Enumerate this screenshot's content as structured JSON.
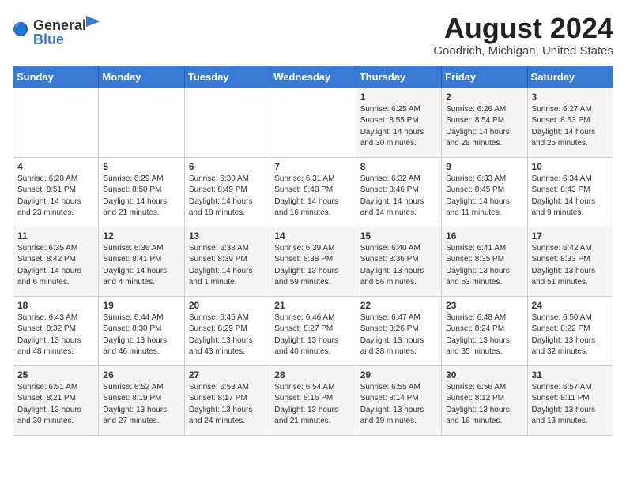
{
  "header": {
    "logo_general": "General",
    "logo_blue": "Blue",
    "month_year": "August 2024",
    "location": "Goodrich, Michigan, United States"
  },
  "days_of_week": [
    "Sunday",
    "Monday",
    "Tuesday",
    "Wednesday",
    "Thursday",
    "Friday",
    "Saturday"
  ],
  "weeks": [
    [
      {
        "day": "",
        "info": ""
      },
      {
        "day": "",
        "info": ""
      },
      {
        "day": "",
        "info": ""
      },
      {
        "day": "",
        "info": ""
      },
      {
        "day": "1",
        "info": "Sunrise: 6:25 AM\nSunset: 8:55 PM\nDaylight: 14 hours\nand 30 minutes."
      },
      {
        "day": "2",
        "info": "Sunrise: 6:26 AM\nSunset: 8:54 PM\nDaylight: 14 hours\nand 28 minutes."
      },
      {
        "day": "3",
        "info": "Sunrise: 6:27 AM\nSunset: 8:53 PM\nDaylight: 14 hours\nand 25 minutes."
      }
    ],
    [
      {
        "day": "4",
        "info": "Sunrise: 6:28 AM\nSunset: 8:51 PM\nDaylight: 14 hours\nand 23 minutes."
      },
      {
        "day": "5",
        "info": "Sunrise: 6:29 AM\nSunset: 8:50 PM\nDaylight: 14 hours\nand 21 minutes."
      },
      {
        "day": "6",
        "info": "Sunrise: 6:30 AM\nSunset: 8:49 PM\nDaylight: 14 hours\nand 18 minutes."
      },
      {
        "day": "7",
        "info": "Sunrise: 6:31 AM\nSunset: 8:48 PM\nDaylight: 14 hours\nand 16 minutes."
      },
      {
        "day": "8",
        "info": "Sunrise: 6:32 AM\nSunset: 8:46 PM\nDaylight: 14 hours\nand 14 minutes."
      },
      {
        "day": "9",
        "info": "Sunrise: 6:33 AM\nSunset: 8:45 PM\nDaylight: 14 hours\nand 11 minutes."
      },
      {
        "day": "10",
        "info": "Sunrise: 6:34 AM\nSunset: 8:43 PM\nDaylight: 14 hours\nand 9 minutes."
      }
    ],
    [
      {
        "day": "11",
        "info": "Sunrise: 6:35 AM\nSunset: 8:42 PM\nDaylight: 14 hours\nand 6 minutes."
      },
      {
        "day": "12",
        "info": "Sunrise: 6:36 AM\nSunset: 8:41 PM\nDaylight: 14 hours\nand 4 minutes."
      },
      {
        "day": "13",
        "info": "Sunrise: 6:38 AM\nSunset: 8:39 PM\nDaylight: 14 hours\nand 1 minute."
      },
      {
        "day": "14",
        "info": "Sunrise: 6:39 AM\nSunset: 8:38 PM\nDaylight: 13 hours\nand 59 minutes."
      },
      {
        "day": "15",
        "info": "Sunrise: 6:40 AM\nSunset: 8:36 PM\nDaylight: 13 hours\nand 56 minutes."
      },
      {
        "day": "16",
        "info": "Sunrise: 6:41 AM\nSunset: 8:35 PM\nDaylight: 13 hours\nand 53 minutes."
      },
      {
        "day": "17",
        "info": "Sunrise: 6:42 AM\nSunset: 8:33 PM\nDaylight: 13 hours\nand 51 minutes."
      }
    ],
    [
      {
        "day": "18",
        "info": "Sunrise: 6:43 AM\nSunset: 8:32 PM\nDaylight: 13 hours\nand 48 minutes."
      },
      {
        "day": "19",
        "info": "Sunrise: 6:44 AM\nSunset: 8:30 PM\nDaylight: 13 hours\nand 46 minutes."
      },
      {
        "day": "20",
        "info": "Sunrise: 6:45 AM\nSunset: 8:29 PM\nDaylight: 13 hours\nand 43 minutes."
      },
      {
        "day": "21",
        "info": "Sunrise: 6:46 AM\nSunset: 8:27 PM\nDaylight: 13 hours\nand 40 minutes."
      },
      {
        "day": "22",
        "info": "Sunrise: 6:47 AM\nSunset: 8:26 PM\nDaylight: 13 hours\nand 38 minutes."
      },
      {
        "day": "23",
        "info": "Sunrise: 6:48 AM\nSunset: 8:24 PM\nDaylight: 13 hours\nand 35 minutes."
      },
      {
        "day": "24",
        "info": "Sunrise: 6:50 AM\nSunset: 8:22 PM\nDaylight: 13 hours\nand 32 minutes."
      }
    ],
    [
      {
        "day": "25",
        "info": "Sunrise: 6:51 AM\nSunset: 8:21 PM\nDaylight: 13 hours\nand 30 minutes."
      },
      {
        "day": "26",
        "info": "Sunrise: 6:52 AM\nSunset: 8:19 PM\nDaylight: 13 hours\nand 27 minutes."
      },
      {
        "day": "27",
        "info": "Sunrise: 6:53 AM\nSunset: 8:17 PM\nDaylight: 13 hours\nand 24 minutes."
      },
      {
        "day": "28",
        "info": "Sunrise: 6:54 AM\nSunset: 8:16 PM\nDaylight: 13 hours\nand 21 minutes."
      },
      {
        "day": "29",
        "info": "Sunrise: 6:55 AM\nSunset: 8:14 PM\nDaylight: 13 hours\nand 19 minutes."
      },
      {
        "day": "30",
        "info": "Sunrise: 6:56 AM\nSunset: 8:12 PM\nDaylight: 13 hours\nand 16 minutes."
      },
      {
        "day": "31",
        "info": "Sunrise: 6:57 AM\nSunset: 8:11 PM\nDaylight: 13 hours\nand 13 minutes."
      }
    ]
  ]
}
